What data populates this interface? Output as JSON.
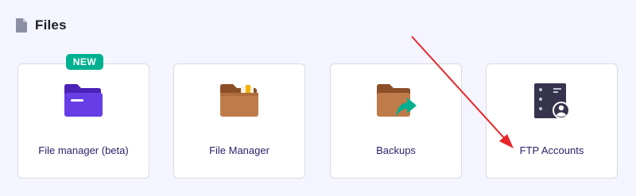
{
  "section": {
    "title": "Files",
    "icon": "file-icon"
  },
  "cards": [
    {
      "label": "File manager (beta)",
      "icon": "purple-folder-icon",
      "badge": "NEW"
    },
    {
      "label": "File Manager",
      "icon": "brown-folder-icon"
    },
    {
      "label": "Backups",
      "icon": "backup-folder-icon"
    },
    {
      "label": "FTP Accounts",
      "icon": "ftp-server-user-icon"
    }
  ],
  "colors": {
    "background": "#f4f5ff",
    "card_label": "#2f1c6a",
    "badge": "#00b090",
    "purple_folder": "#673de6",
    "brown_folder": "#c07b4a",
    "backup_arrow": "#00b090",
    "annotation_arrow": "#e8262a"
  }
}
